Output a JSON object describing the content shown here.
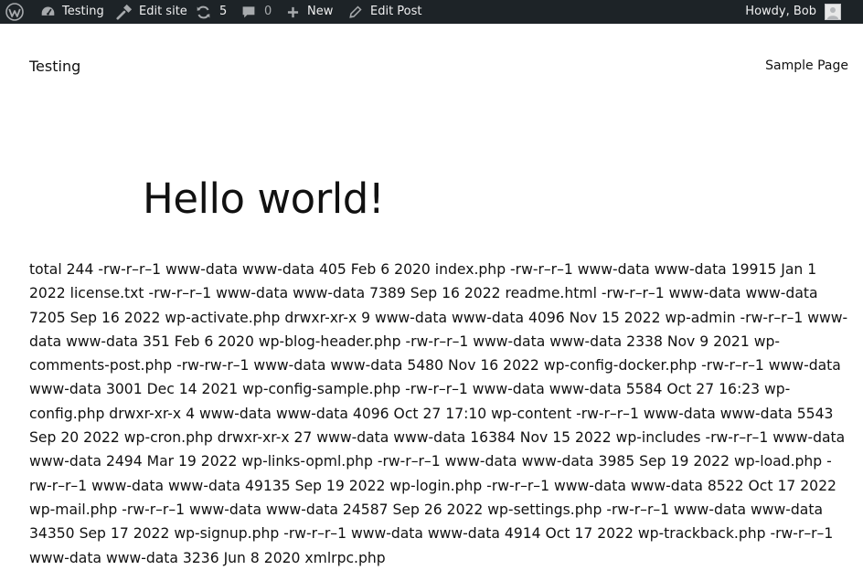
{
  "admin_bar": {
    "site_name": "Testing",
    "edit_site": "Edit site",
    "updates_count": "5",
    "comments_count": "0",
    "new_label": "New",
    "edit_post": "Edit Post",
    "howdy": "Howdy, Bob",
    "icons": [
      "wordpress-logo-icon",
      "customize-icon",
      "updates-icon",
      "comments-icon",
      "plus-icon",
      "edit-icon",
      "avatar"
    ],
    "colors": {
      "bar_bg": "#1d2327",
      "text": "#f0f0f1",
      "icon": "#a7aaad"
    }
  },
  "site": {
    "title": "Testing",
    "nav": [
      "Sample Page"
    ]
  },
  "post": {
    "title": "Hello world!",
    "content": "total 244 -rw-r–r–1 www-data www-data 405 Feb 6 2020 index.php -rw-r–r–1 www-data www-data 19915 Jan 1 2022 license.txt -rw-r–r–1 www-data www-data 7389 Sep 16 2022 readme.html -rw-r–r–1 www-data www-data 7205 Sep 16 2022 wp-activate.php drwxr-xr-x 9 www-data www-data 4096 Nov 15 2022 wp-admin -rw-r–r–1 www-data www-data 351 Feb 6 2020 wp-blog-header.php -rw-r–r–1 www-data www-data 2338 Nov 9 2021 wp-comments-post.php -rw-rw-r–1 www-data www-data 5480 Nov 16 2022 wp-config-docker.php -rw-r–r–1 www-data www-data 3001 Dec 14 2021 wp-config-sample.php -rw-r–r–1 www-data www-data 5584 Oct 27 16:23 wp-config.php drwxr-xr-x 4 www-data www-data 4096 Oct 27 17:10 wp-content -rw-r–r–1 www-data www-data 5543 Sep 20 2022 wp-cron.php drwxr-xr-x 27 www-data www-data 16384 Nov 15 2022 wp-includes -rw-r–r–1 www-data www-data 2494 Mar 19 2022 wp-links-opml.php -rw-r–r–1 www-data www-data 3985 Sep 19 2022 wp-load.php -rw-r–r–1 www-data www-data 49135 Sep 19 2022 wp-login.php -rw-r–r–1 www-data www-data 8522 Oct 17 2022 wp-mail.php -rw-r–r–1 www-data www-data 24587 Sep 26 2022 wp-settings.php -rw-r–r–1 www-data www-data 34350 Sep 17 2022 wp-signup.php -rw-r–r–1 www-data www-data 4914 Oct 17 2022 wp-trackback.php -rw-r–r–1 www-data www-data 3236 Jun 8 2020 xmlrpc.php"
  }
}
